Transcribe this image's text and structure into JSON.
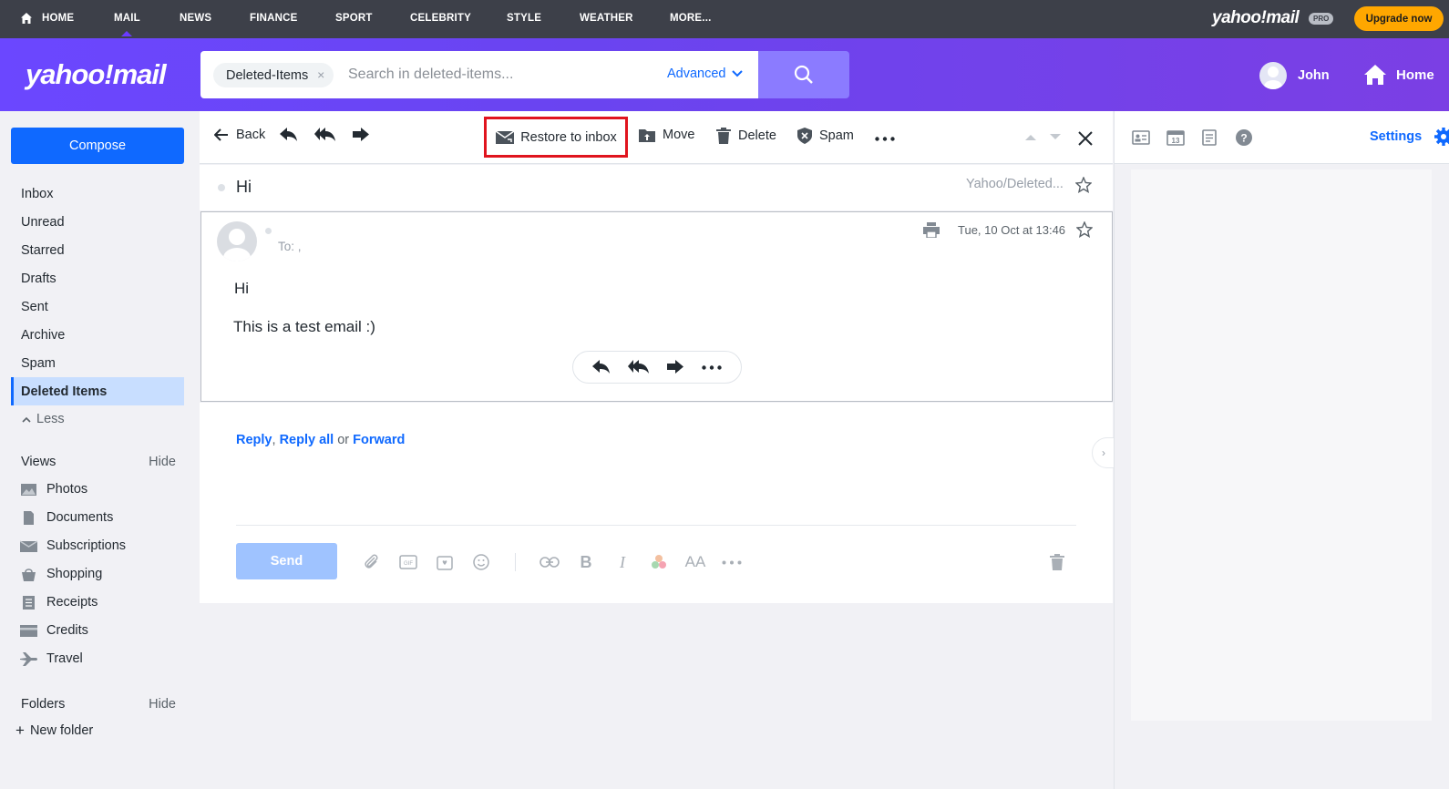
{
  "topnav": {
    "items": [
      {
        "label": "HOME"
      },
      {
        "label": "MAIL"
      },
      {
        "label": "NEWS"
      },
      {
        "label": "FINANCE"
      },
      {
        "label": "SPORT"
      },
      {
        "label": "CELEBRITY"
      },
      {
        "label": "STYLE"
      },
      {
        "label": "WEATHER"
      },
      {
        "label": "MORE..."
      }
    ],
    "active": "MAIL",
    "brand": "yahoo!mail",
    "pro_badge": "PRO",
    "upgrade_label": "Upgrade now"
  },
  "header": {
    "logo": "yahoo!mail",
    "search_chip": "Deleted-Items",
    "search_chip_close": "×",
    "search_placeholder": "Search in deleted-items...",
    "advanced_label": "Advanced",
    "user_name": "John",
    "home_label": "Home"
  },
  "sidebar": {
    "compose_label": "Compose",
    "folders": [
      {
        "label": "Inbox"
      },
      {
        "label": "Unread"
      },
      {
        "label": "Starred"
      },
      {
        "label": "Drafts"
      },
      {
        "label": "Sent"
      },
      {
        "label": "Archive"
      },
      {
        "label": "Spam"
      },
      {
        "label": "Deleted Items"
      }
    ],
    "active_folder": "Deleted Items",
    "less_label": "Less",
    "views_title": "Views",
    "views_hide": "Hide",
    "views": [
      {
        "label": "Photos",
        "icon": "photo-icon"
      },
      {
        "label": "Documents",
        "icon": "document-icon"
      },
      {
        "label": "Subscriptions",
        "icon": "subscriptions-icon"
      },
      {
        "label": "Shopping",
        "icon": "shopping-bag-icon"
      },
      {
        "label": "Receipts",
        "icon": "receipt-icon"
      },
      {
        "label": "Credits",
        "icon": "credit-card-icon"
      },
      {
        "label": "Travel",
        "icon": "plane-icon"
      }
    ],
    "folders_title": "Folders",
    "folders_hide": "Hide",
    "new_folder_label": "New folder"
  },
  "toolbar": {
    "back_label": "Back",
    "restore_label": "Restore to inbox",
    "move_label": "Move",
    "delete_label": "Delete",
    "spam_label": "Spam"
  },
  "message": {
    "subject": "Hi",
    "folder_path": "Yahoo/Deleted...",
    "to_label": "To: ,",
    "date": "Tue, 10 Oct at 13:46",
    "body_greeting": "Hi",
    "body_text": "This is a test email :)"
  },
  "reply": {
    "reply_label": "Reply",
    "reply_all_label": "Reply all",
    "or_label": "or",
    "forward_label": "Forward",
    "send_label": "Send"
  },
  "right_panel": {
    "settings_label": "Settings"
  },
  "colors": {
    "accent": "#0f69ff",
    "header_purple": "#6b47ff",
    "restore_highlight": "#e0141e",
    "upgrade": "#ffa700"
  }
}
